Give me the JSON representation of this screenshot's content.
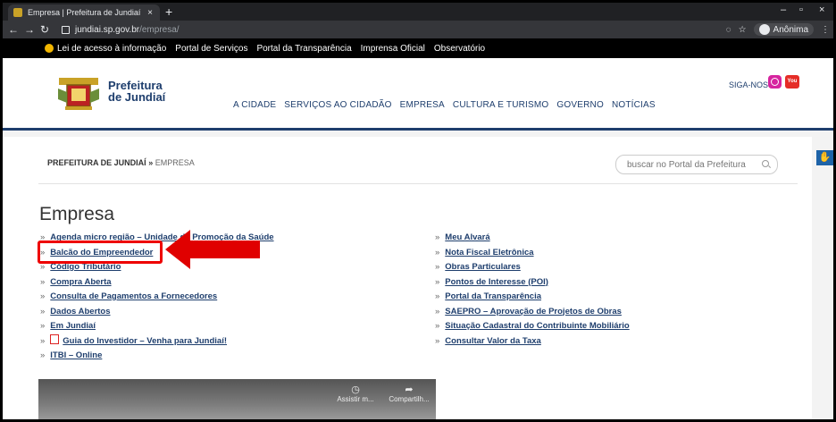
{
  "browser": {
    "tab_title": "Empresa | Prefeitura de Jundiaí",
    "url_host": "jundiai.sp.gov.br",
    "url_path": "/empresa/",
    "profile_label": "Anônima"
  },
  "top_links": [
    "Lei de acesso à informação",
    "Portal de Serviços",
    "Portal da Transparência",
    "Imprensa Oficial",
    "Observatório"
  ],
  "header": {
    "logo_line1": "Prefeitura",
    "logo_line2": "de Jundiaí",
    "siga_label": "SIGA-NOS",
    "youtube_label": "You",
    "nav": [
      "A CIDADE",
      "SERVIÇOS AO CIDADÃO",
      "EMPRESA",
      "CULTURA E TURISMO",
      "GOVERNO",
      "NOTÍCIAS"
    ]
  },
  "breadcrumb": {
    "root": "PREFEITURA DE JUNDIAÍ",
    "sep": "»",
    "current": "EMPRESA"
  },
  "search": {
    "placeholder": "buscar no Portal da Prefeitura"
  },
  "page": {
    "title": "Empresa",
    "left_links": [
      "Agenda micro região – Unidade de Promoção da Saúde",
      "Balcão do Empreendedor",
      "Código Tributário",
      "Compra Aberta",
      "Consulta de Pagamentos a Fornecedores",
      "Dados Abertos",
      "Em Jundiaí",
      "Guia do Investidor – Venha para Jundiaí!",
      "ITBI – Online"
    ],
    "right_links": [
      "Meu Alvará",
      "Nota Fiscal Eletrônica",
      "Obras Particulares",
      "Pontos de Interesse (POI)",
      "Portal da Transparência",
      "SAEPRO – Aprovação de Projetos de Obras",
      "Situação Cadastral do Contribuinte Mobiliário",
      "Consultar Valor da Taxa"
    ],
    "bullet": "»"
  },
  "video": {
    "watch_later": "Assistir m...",
    "share": "Compartilh..."
  },
  "colors": {
    "brand": "#1e3e6d",
    "highlight": "#e00000"
  }
}
